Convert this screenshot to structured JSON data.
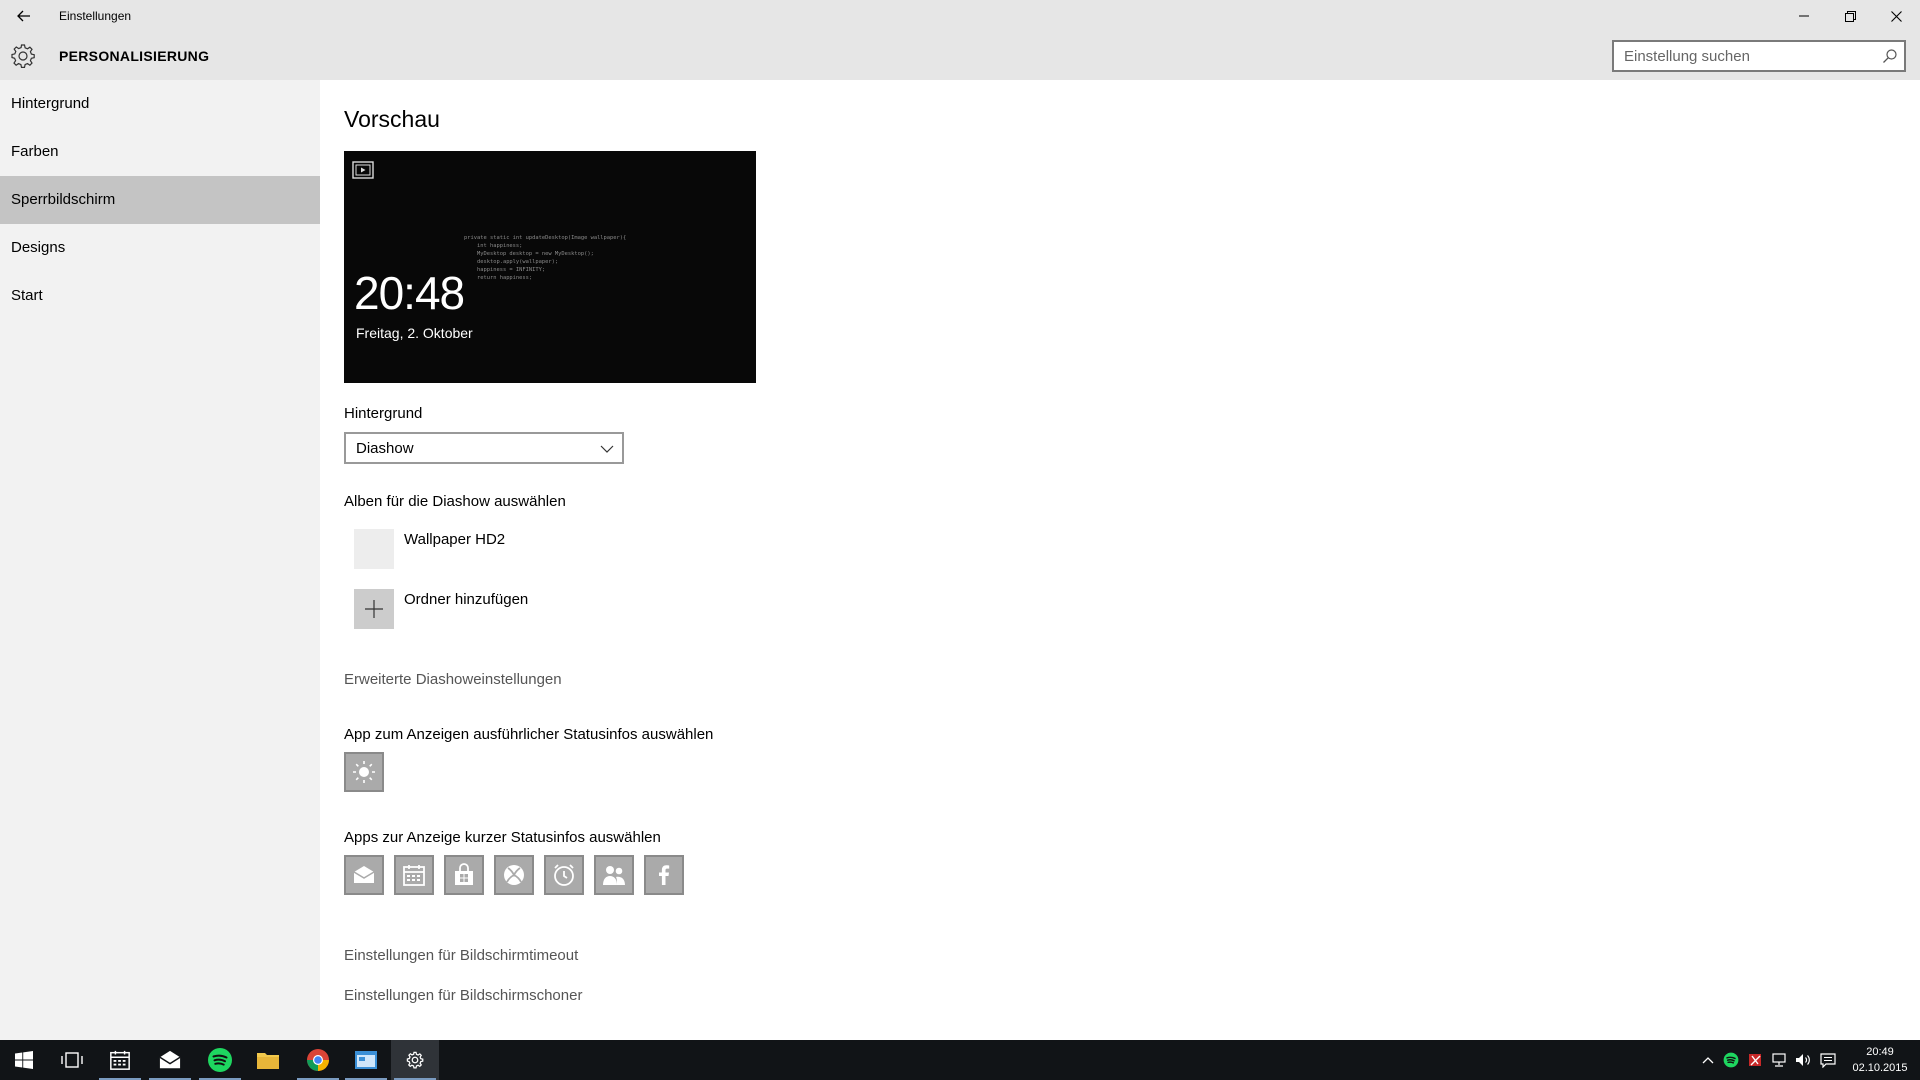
{
  "window": {
    "title": "Einstellungen",
    "section_title": "PERSONALISIERUNG",
    "search_placeholder": "Einstellung suchen"
  },
  "sidebar": {
    "items": [
      {
        "label": "Hintergrund",
        "selected": false
      },
      {
        "label": "Farben",
        "selected": false
      },
      {
        "label": "Sperrbildschirm",
        "selected": true
      },
      {
        "label": "Designs",
        "selected": false
      },
      {
        "label": "Start",
        "selected": false
      }
    ]
  },
  "content": {
    "preview_heading": "Vorschau",
    "preview": {
      "time": "20:48",
      "date": "Freitag, 2. Oktober",
      "code_lines": [
        "private static int updateDesktop(Image wallpaper){",
        "    int happiness;",
        "    MyDesktop desktop = new MyDesktop();",
        "    desktop.apply(wallpaper);",
        "    happiness = INFINITY;",
        "    return happiness;"
      ]
    },
    "background_label": "Hintergrund",
    "background_value": "Diashow",
    "albums_label": "Alben für die Diashow auswählen",
    "album_name": "Wallpaper HD2",
    "add_folder_label": "Ordner hinzufügen",
    "advanced_slideshow_link": "Erweiterte Diashoweinstellungen",
    "detailed_status_label": "App zum Anzeigen ausführlicher Statusinfos auswählen",
    "detailed_status_app_icon": "weather-sun-icon",
    "quick_status_label": "Apps zur Anzeige kurzer Statusinfos auswählen",
    "quick_status_apps": [
      "mail-icon",
      "calendar-icon",
      "store-icon",
      "xbox-icon",
      "alarm-icon",
      "people-icon",
      "facebook-icon"
    ],
    "screen_timeout_link": "Einstellungen für Bildschirmtimeout",
    "screensaver_link": "Einstellungen für Bildschirmschoner"
  },
  "taskbar": {
    "apps": [
      "start-icon",
      "task-view-icon",
      "calendar-icon",
      "mail-icon",
      "spotify-icon",
      "file-explorer-icon",
      "chrome-icon",
      "window-app-icon",
      "settings-icon"
    ],
    "clock_time": "20:49",
    "clock_date": "02.10.2015"
  },
  "colors": {
    "chrome_bg": "#e6e6e6",
    "sidebar_bg": "#f2f2f2",
    "sidebar_selected": "#c4c4c4",
    "content_bg": "#ffffff",
    "taskbar_bg": "#111417",
    "tile_bg": "#aaaaaa",
    "link": "#555555"
  }
}
